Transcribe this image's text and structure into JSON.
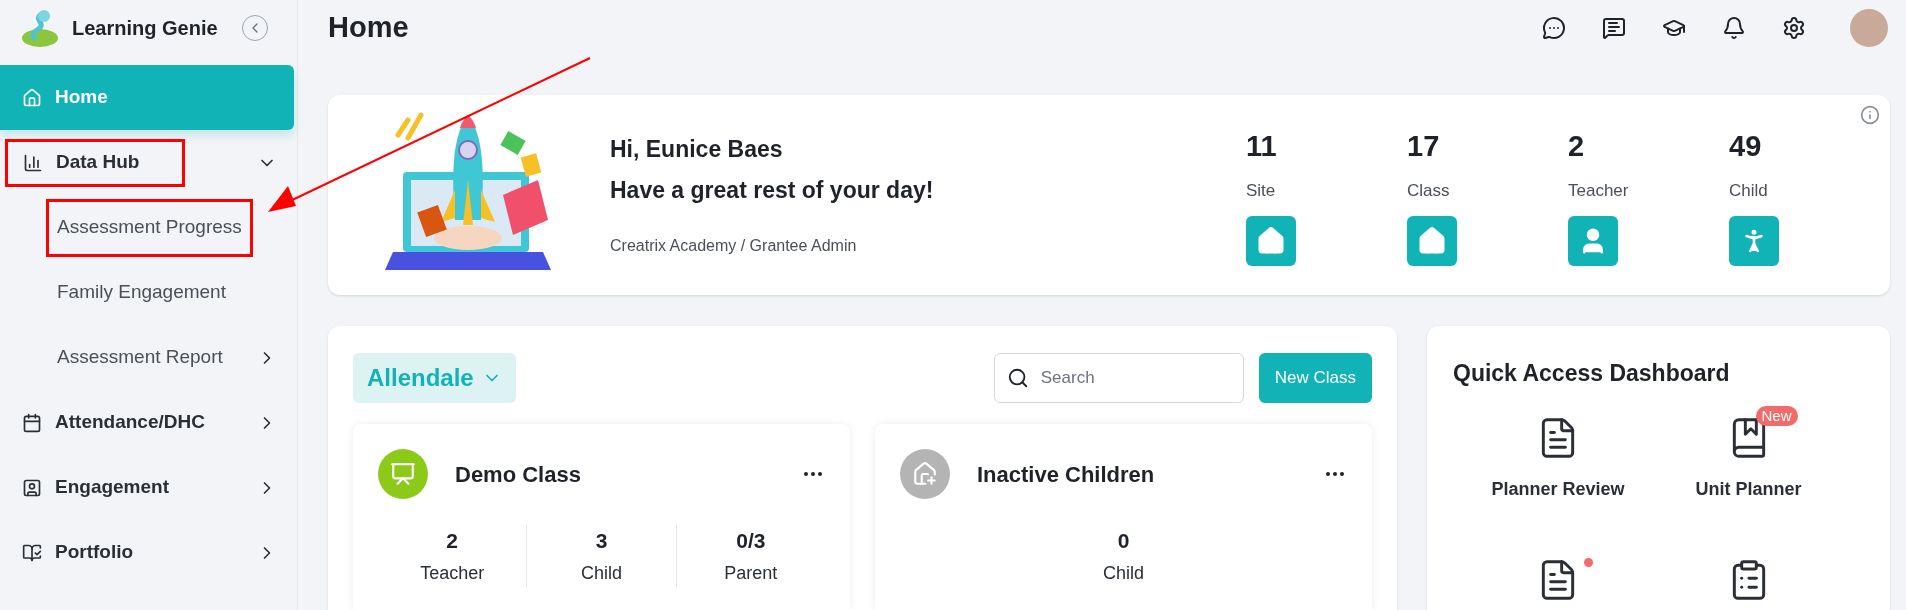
{
  "app": {
    "name": "Learning Genie"
  },
  "sidebar": {
    "items": [
      {
        "label": "Home",
        "kind": "home",
        "selected": true,
        "expanded": false,
        "annotated": false
      },
      {
        "label": "Data Hub",
        "kind": "chart",
        "selected": false,
        "expanded": true,
        "annotated": true,
        "children": [
          {
            "label": "Assessment Progress",
            "selected": false,
            "annotated": true,
            "has_submenu": false
          },
          {
            "label": "Family Engagement",
            "selected": false,
            "annotated": false,
            "has_submenu": false
          },
          {
            "label": "Assessment Report",
            "selected": false,
            "annotated": false,
            "has_submenu": true
          }
        ]
      },
      {
        "label": "Attendance/DHC",
        "kind": "calendar",
        "selected": false,
        "expanded": false,
        "annotated": false
      },
      {
        "label": "Engagement",
        "kind": "engagement",
        "selected": false,
        "expanded": false,
        "annotated": false
      },
      {
        "label": "Portfolio",
        "kind": "portfolio",
        "selected": false,
        "expanded": false,
        "annotated": false
      }
    ]
  },
  "header": {
    "title": "Home"
  },
  "welcome": {
    "greeting": "Hi, Eunice Baes",
    "message": "Have a great rest of your day!",
    "organization": "Creatrix Academy / Grantee Admin",
    "stats": [
      {
        "value": "11",
        "label": "Site",
        "kind": "site"
      },
      {
        "value": "17",
        "label": "Class",
        "kind": "class"
      },
      {
        "value": "2",
        "label": "Teacher",
        "kind": "teacher"
      },
      {
        "value": "49",
        "label": "Child",
        "kind": "child"
      }
    ]
  },
  "classes": {
    "site_filter": "Allendale",
    "search": {
      "placeholder": "Search"
    },
    "new_button": "New Class",
    "cards": [
      {
        "title": "Demo Class",
        "kind": "active",
        "stats": [
          {
            "value": "2",
            "label": "Teacher"
          },
          {
            "value": "3",
            "label": "Child"
          },
          {
            "value": "0/3",
            "label": "Parent"
          }
        ]
      },
      {
        "title": "Inactive Children",
        "kind": "inactive",
        "stats": [
          {
            "value": "0",
            "label": "Child"
          }
        ]
      }
    ]
  },
  "quick_access": {
    "title": "Quick Access Dashboard",
    "items": [
      {
        "label": "Planner Review",
        "kind": "document",
        "dot": false
      },
      {
        "label": "Unit Planner",
        "kind": "book",
        "badge": "New",
        "dot": false
      },
      {
        "kind": "profile-doc",
        "dot": true
      },
      {
        "kind": "clipboard",
        "dot": false
      }
    ]
  }
}
